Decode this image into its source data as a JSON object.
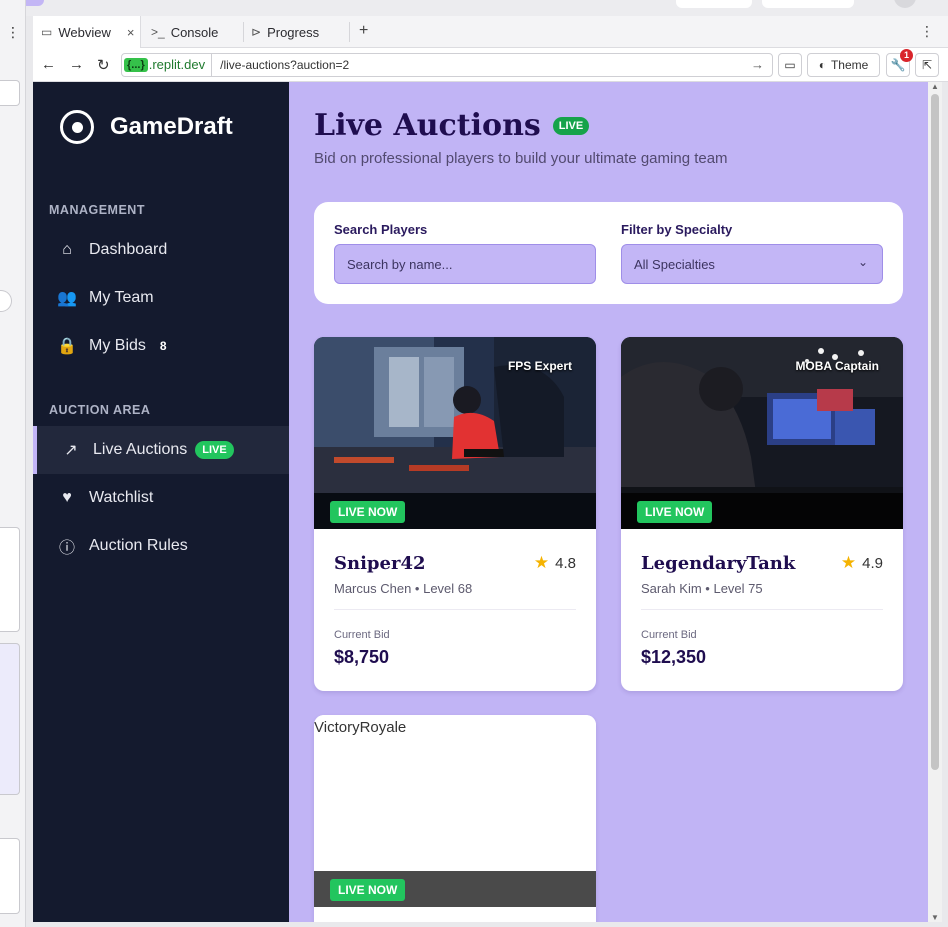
{
  "browser": {
    "tabs": [
      {
        "label": "Webview",
        "icon": "monitor-icon"
      },
      {
        "label": "Console",
        "icon": "terminal-icon"
      },
      {
        "label": "Progress",
        "icon": "progress-icon"
      }
    ],
    "url_badge": "{...}",
    "url_host": ".replit.dev",
    "url_path": "/live-auctions?auction=2",
    "theme_label": "Theme",
    "notification_count": "1"
  },
  "sidebar": {
    "brand": "GameDraft",
    "management_title": "MANAGEMENT",
    "auction_title": "AUCTION AREA",
    "management_items": [
      {
        "label": "Dashboard",
        "icon": "home-icon"
      },
      {
        "label": "My Team",
        "icon": "users-icon"
      },
      {
        "label": "My Bids",
        "icon": "lock-icon",
        "count": "8"
      }
    ],
    "auction_items": [
      {
        "label": "Live Auctions",
        "icon": "trending-up-icon",
        "badge": "LIVE",
        "active": true
      },
      {
        "label": "Watchlist",
        "icon": "heart-icon"
      },
      {
        "label": "Auction Rules",
        "icon": "info-icon"
      }
    ]
  },
  "main": {
    "title": "Live Auctions",
    "title_badge": "LIVE",
    "subtitle": "Bid on professional players to build your ultimate gaming team",
    "search_label": "Search Players",
    "search_placeholder": "Search by name...",
    "filter_label": "Filter by Specialty",
    "filter_value": "All Specialties",
    "cards": [
      {
        "specialty": "FPS Expert",
        "live_label": "LIVE NOW",
        "name": "Sniper42",
        "meta": "Marcus Chen • Level 68",
        "rating": "4.8",
        "bid_label": "Current Bid",
        "bid": "$8,750"
      },
      {
        "specialty": "MOBA Captain",
        "live_label": "LIVE NOW",
        "name": "LegendaryTank",
        "meta": "Sarah Kim • Level 75",
        "rating": "4.9",
        "bid_label": "Current Bid",
        "bid": "$12,350"
      },
      {
        "alt_text": "VictoryRoyale",
        "live_label": "LIVE NOW"
      }
    ]
  },
  "colors": {
    "sidebar_bg": "#141a2e",
    "main_bg": "#c1b4f5",
    "live_green": "#22c55e",
    "title_color": "#1f0d4f"
  }
}
